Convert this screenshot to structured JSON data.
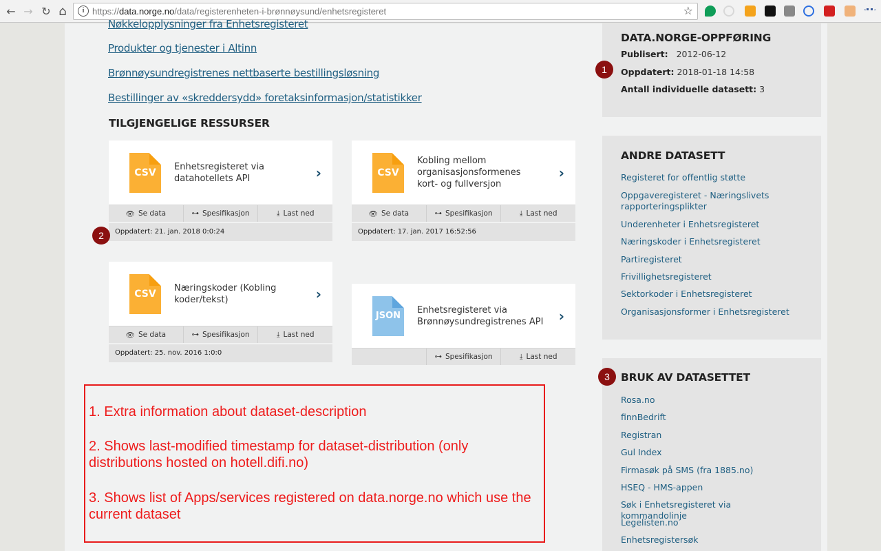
{
  "browser": {
    "url_prefix": "https://",
    "url_domain": "data.norge.no",
    "url_path": "/data/registerenheten-i-brønnøysund/enhetsregisteret",
    "icons": {
      "back": "←",
      "forward": "→",
      "reload": "↻",
      "home": "⌂",
      "info": "i",
      "star": "☆"
    },
    "extensions": [
      "hangouts-icon",
      "sync-icon",
      "chart-extension-icon",
      "document-extension-icon",
      "camera-icon",
      "wave-extension-icon",
      "lastpass-icon",
      "face-extension-icon",
      "dots-extension-icon"
    ]
  },
  "main": {
    "links": [
      "Nøkkelopplysninger fra Enhetsregisteret",
      "Produkter og tjenester i Altinn",
      "Brønnøysundregistrenes nettbaserte bestillingsløsning",
      "Bestillinger av «skreddersydd» foretaksinformasjon/statistikker"
    ],
    "resources_title": "TILGJENGELIGE RESSURSER",
    "resources": [
      {
        "format": "CSV",
        "title": "Enhetsregisteret via datahotellets API",
        "actions": [
          "Se data",
          "Spesifikasjon",
          "Last ned"
        ],
        "updated": "Oppdatert: 21. jan. 2018 0:0:24"
      },
      {
        "format": "CSV",
        "title": "Kobling mellom organisasjonsformenes kort- og fullversjon",
        "actions": [
          "Se data",
          "Spesifikasjon",
          "Last ned"
        ],
        "updated": "Oppdatert: 17. jan. 2017 16:52:56"
      },
      {
        "format": "CSV",
        "title": "Næringskoder (Kobling koder/tekst)",
        "actions": [
          "Se data",
          "Spesifikasjon",
          "Last ned"
        ],
        "updated": "Oppdatert: 25. nov. 2016 1:0:0"
      },
      {
        "format": "JSON",
        "title": "Enhetsregisteret via Brønnøysundregistrenes API",
        "actions": [
          "Spesifikasjon",
          "Last ned"
        ]
      }
    ]
  },
  "sidebar": {
    "entry": {
      "title": "DATA.NORGE-OPPFØRING",
      "published_label": "Publisert:",
      "published_value": "2012-06-12",
      "updated_label": "Oppdatert:",
      "updated_value": "2018-01-18 14:58",
      "count_label": "Antall individuelle datasett:",
      "count_value": "3"
    },
    "other": {
      "title": "ANDRE DATASETT",
      "items": [
        "Registeret for offentlig støtte",
        "Oppgaveregisteret - Næringslivets rapporteringsplikter",
        "Underenheter i Enhetsregisteret",
        "Næringskoder i Enhetsregisteret",
        "Partiregisteret",
        "Frivillighetsregisteret",
        "Sektorkoder i Enhetsregisteret",
        "Organisasjonsformer i Enhetsregisteret"
      ]
    },
    "usage": {
      "title": "BRUK AV DATASETTET",
      "items": [
        "Rosa.no",
        "finnBedrift",
        "Registran",
        "Gul Index",
        "Firmasøk på SMS (fra 1885.no)",
        "HSEQ - HMS-appen",
        "Søk i Enhetsregisteret via kommandolinje",
        "Legelisten.no",
        "Enhetsregistersøk"
      ]
    }
  },
  "badges": [
    "1",
    "2",
    "3"
  ],
  "annotation": {
    "lines": [
      "1. Extra information about dataset-description",
      "2. Shows last-modified timestamp for dataset-distribution (only distributions hosted on hotell.difi.no)",
      "3. Shows list of Apps/services registered on data.norge.no which use the current dataset"
    ]
  },
  "colors": {
    "csv": "#fbb034",
    "csv_fold": "#f79f10",
    "json": "#8ec3ea",
    "json_fold": "#5fa6de",
    "link": "#1f5f82",
    "badge": "#8b1010",
    "annotation": "#ee1c1c"
  }
}
